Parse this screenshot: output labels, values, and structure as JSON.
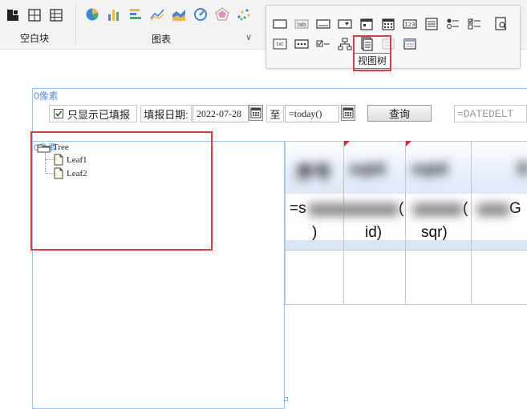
{
  "ribbon": {
    "blank_group_label": "空白块",
    "chart_group_label": "图表",
    "chart_group_chevron": "∨",
    "chart_icons": [
      "pie-chart-icon",
      "bar-chart-icon",
      "horizontal-bar-icon",
      "line-chart-icon",
      "area-chart-icon",
      "gauge-chart-icon",
      "radar-chart-icon",
      "scatter-chart-icon"
    ]
  },
  "popup": {
    "tooltip": "视图树",
    "widgets_row1": [
      "rectangle-icon",
      "label-icon",
      "textbox-icon",
      "combobox-icon",
      "date-picker-icon",
      "calendar-icon",
      "number-field-icon",
      "list-icon",
      "radio-group-icon",
      "checkbox-group-icon"
    ],
    "widgets_row2": [
      "text-field-icon",
      "password-icon",
      "checkbox-icon",
      "tree-icon",
      "view-tree-icon",
      "disabled-widget-icon",
      "frame-icon"
    ],
    "extra_icon": "search-doc-icon"
  },
  "canvas": {
    "top_size_label": "0像素",
    "left_size_label": "0像素",
    "filter": {
      "only_filled_label": "只显示已填报",
      "date_label": "填报日期:",
      "date_value": "2022-07-28",
      "to_label": "至",
      "end_value": "=today()",
      "query_label": "查询",
      "formula_value": "=DATEDELT"
    },
    "tree": {
      "root": "Tree",
      "leaves": [
        "Leaf1",
        "Leaf2"
      ]
    },
    "grid": {
      "header_first_col": "序号",
      "header_cells": [
        "sqid",
        "sqid",
        ""
      ],
      "header_last": "D",
      "row2_cells": [
        "=s",
        "(",
        "(",
        "G"
      ],
      "row2_line2": [
        ")",
        "id)",
        "sqr)",
        ""
      ]
    }
  }
}
